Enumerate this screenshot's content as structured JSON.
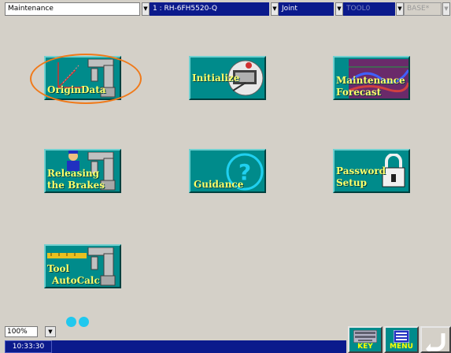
{
  "toolbar": {
    "mode": "Maintenance",
    "robot": "1 : RH-6FH5520-Q",
    "coordinate": "Joint",
    "tool": "TOOL0",
    "base": "BASE*"
  },
  "tiles": {
    "origin_data": "OriginData",
    "initialize": "Initialize",
    "maintenance_forecast_1": "Maintenance",
    "maintenance_forecast_2": "Forecast",
    "releasing_brakes_1": "Releasing",
    "releasing_brakes_2": "the Brakes",
    "guidance": "Guidance",
    "password_setup_1": "Password",
    "password_setup_2": "Setup",
    "tool_autocalc_1": "Tool",
    "tool_autocalc_2": "AutoCalc"
  },
  "footer": {
    "zoom": "100%",
    "time": "10:33:30",
    "key_button": "KEY",
    "menu_button": "MENU"
  },
  "colors": {
    "tile": "#008b8b",
    "tile_text": "#ffff6a",
    "highlight": "#f07a1a",
    "status_bar": "#0b1a8c"
  },
  "icons": {
    "robot_arm": "robot-arm-icon",
    "axes": "coordinate-axes-icon",
    "question": "question-mark-icon",
    "lock": "padlock-icon",
    "keyboard": "keyboard-icon",
    "menu": "menu-icon",
    "return": "return-arrow-icon"
  }
}
